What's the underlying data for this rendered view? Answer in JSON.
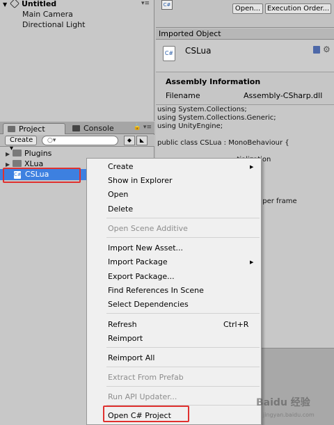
{
  "hierarchy": {
    "scene_title": "Untitled",
    "menu_glyph": "▾≡",
    "items": [
      "Main Camera",
      "Directional Light"
    ]
  },
  "project": {
    "tabs": [
      "Project",
      "Console"
    ],
    "create_label": "Create ▾",
    "folders": [
      "Plugins",
      "XLua"
    ],
    "selected_asset": "CSLua"
  },
  "inspector": {
    "open_label": "Open...",
    "execution_order_label": "Execution Order...",
    "section_header": "Imported Object",
    "asset_name": "CSLua",
    "assembly_title": "Assembly Information",
    "filename_label": "Filename",
    "filename_value": "Assembly-CSharp.dll",
    "code_lines": [
      "using System.Collections;",
      "using System.Collections.Generic;",
      "using UnityEngine;",
      "",
      "public class CSLua : MonoBehaviour {",
      "",
      "                                    tialization",
      "",
      "",
      "",
      "",
      "                                    d once per frame"
    ]
  },
  "context_menu": {
    "items": [
      {
        "label": "Create",
        "submenu": true
      },
      {
        "label": "Show in Explorer"
      },
      {
        "label": "Open"
      },
      {
        "label": "Delete"
      },
      {
        "label": "Open Scene Additive",
        "disabled": true
      },
      {
        "label": "Import New Asset..."
      },
      {
        "label": "Import Package",
        "submenu": true
      },
      {
        "label": "Export Package..."
      },
      {
        "label": "Find References In Scene"
      },
      {
        "label": "Select Dependencies"
      },
      {
        "label": "Refresh",
        "shortcut": "Ctrl+R"
      },
      {
        "label": "Reimport"
      },
      {
        "label": "Reimport All"
      },
      {
        "label": "Extract From Prefab",
        "disabled": true
      },
      {
        "label": "Run API Updater...",
        "disabled": true
      },
      {
        "label": "Open C# Project"
      }
    ]
  },
  "watermark": {
    "line1": "Baidu 经验",
    "line2": "jingyan.baidu.com"
  },
  "colors": {
    "selection": "#3d80e0",
    "highlight_box": "#e0312f",
    "disabled_text": "#8d8d8d"
  }
}
